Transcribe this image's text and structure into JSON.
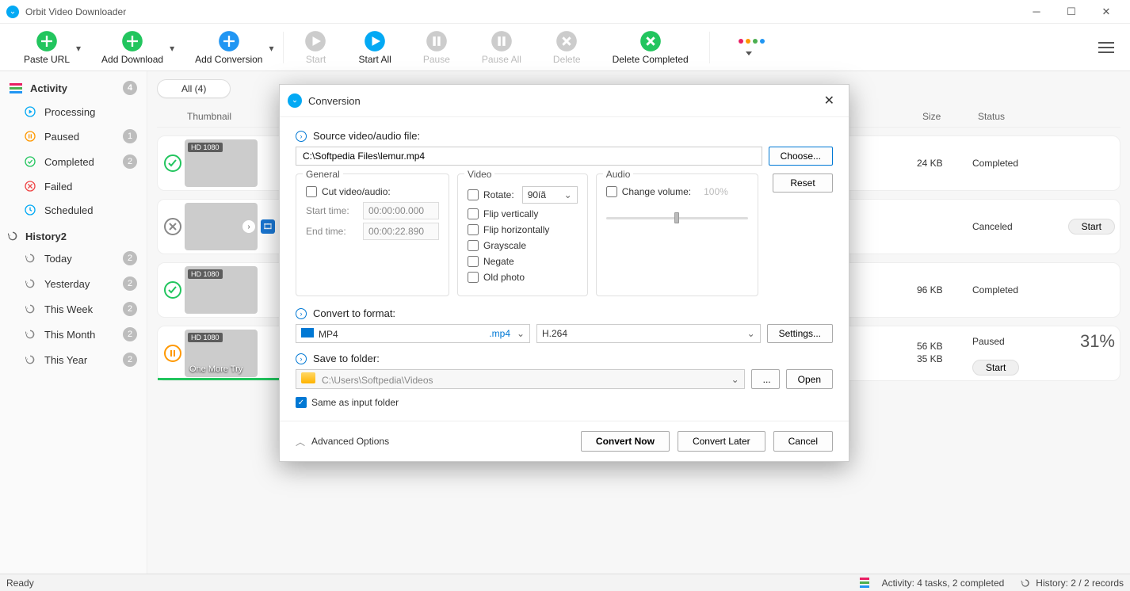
{
  "app": {
    "title": "Orbit Video Downloader"
  },
  "window": {
    "minimize": "–",
    "maximize": "▢",
    "close": "✕"
  },
  "toolbar": {
    "paste_url": "Paste URL",
    "add_download": "Add Download",
    "add_conversion": "Add Conversion",
    "start": "Start",
    "start_all": "Start All",
    "pause": "Pause",
    "pause_all": "Pause All",
    "delete": "Delete",
    "delete_completed": "Delete Completed"
  },
  "sidebar": {
    "activity": {
      "label": "Activity",
      "count": "4"
    },
    "items": {
      "processing": {
        "label": "Processing",
        "count": ""
      },
      "paused": {
        "label": "Paused",
        "count": "1"
      },
      "completed": {
        "label": "Completed",
        "count": "2"
      },
      "failed": {
        "label": "Failed",
        "count": ""
      },
      "scheduled": {
        "label": "Scheduled",
        "count": ""
      }
    },
    "history": {
      "label": "History",
      "count": "2"
    },
    "hist_items": {
      "today": {
        "label": "Today",
        "count": "2"
      },
      "yesterday": {
        "label": "Yesterday",
        "count": "2"
      },
      "this_week": {
        "label": "This Week",
        "count": "2"
      },
      "this_month": {
        "label": "This Month",
        "count": "2"
      },
      "this_year": {
        "label": "This Year",
        "count": "2"
      }
    }
  },
  "filters": {
    "all": "All (4)"
  },
  "cols": {
    "thumbnail": "Thumbnail",
    "size": "Size",
    "status": "Status"
  },
  "rows": {
    "r1": {
      "hd": "HD 1080",
      "size": "24 KB",
      "status": "Completed"
    },
    "r2": {
      "size": "",
      "status": "Canceled",
      "start_btn": "Start"
    },
    "r3": {
      "hd": "HD 1080",
      "size": "96 KB",
      "status": "Completed"
    },
    "r4": {
      "hd": "HD 1080",
      "caption": "One More Try",
      "size1": "56 KB",
      "size2": "35 KB",
      "status": "Paused",
      "pct": "31%",
      "start_btn": "Start"
    }
  },
  "statusbar": {
    "ready": "Ready",
    "activity": "Activity: 4 tasks, 2 completed",
    "history": "History: 2 / 2 records"
  },
  "dialog": {
    "title": "Conversion",
    "src_label": "Source video/audio file:",
    "src_value": "C:\\Softpedia Files\\lemur.mp4",
    "choose": "Choose...",
    "reset": "Reset",
    "general": {
      "title": "General",
      "cut": "Cut video/audio:",
      "start_label": "Start time:",
      "start_value": "00:00:00.000",
      "end_label": "End time:",
      "end_value": "00:00:22.890"
    },
    "video": {
      "title": "Video",
      "rotate": "Rotate:",
      "rotate_val": "90íã",
      "flip_v": "Flip vertically",
      "flip_h": "Flip horizontally",
      "gray": "Grayscale",
      "negate": "Negate",
      "old": "Old photo"
    },
    "audio": {
      "title": "Audio",
      "change_vol": "Change volume:",
      "vol_value": "100%"
    },
    "convert_to": "Convert to format:",
    "format": "MP4",
    "ext": ".mp4",
    "codec": "H.264",
    "settings": "Settings...",
    "save_to": "Save to folder:",
    "save_path": "C:\\Users\\Softpedia\\Videos",
    "browse": "...",
    "open": "Open",
    "same_folder": "Same as input folder",
    "advanced": "Advanced Options",
    "convert_now": "Convert Now",
    "convert_later": "Convert Later",
    "cancel": "Cancel"
  }
}
